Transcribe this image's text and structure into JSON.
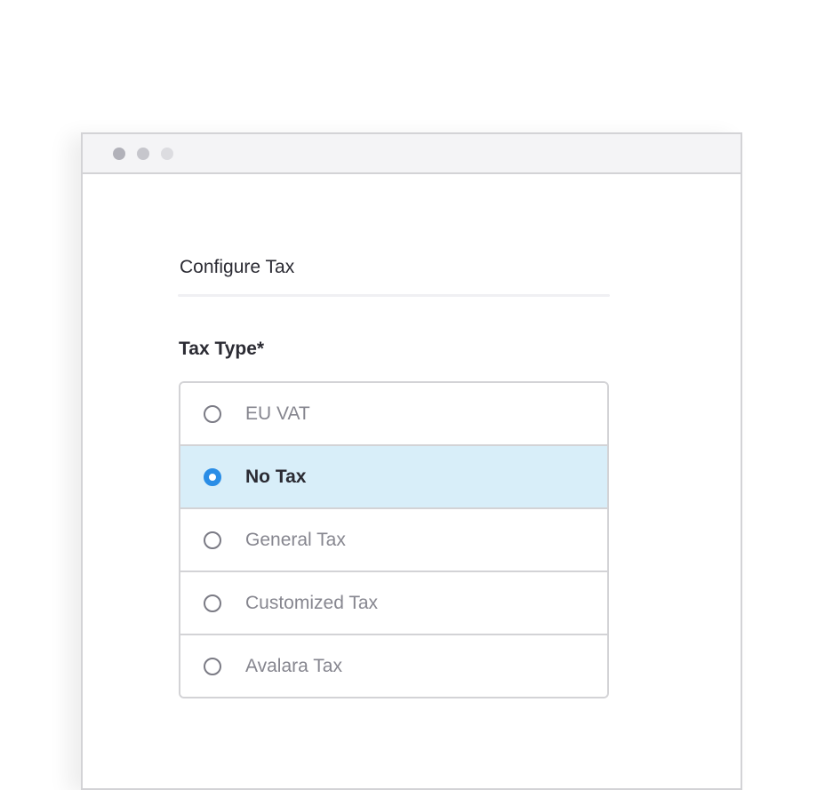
{
  "window": {
    "controls": [
      "close-dot",
      "minimize-dot",
      "maximize-dot"
    ]
  },
  "form": {
    "title": "Configure Tax",
    "field_label": "Tax Type*",
    "selected_value": "No Tax",
    "options": [
      {
        "label": "EU VAT",
        "selected": false
      },
      {
        "label": "No Tax",
        "selected": true
      },
      {
        "label": "General Tax",
        "selected": false
      },
      {
        "label": "Customized Tax",
        "selected": false
      },
      {
        "label": "Avalara Tax",
        "selected": false
      }
    ]
  },
  "colors": {
    "accent": "#2a8de6",
    "selected_row_bg": "#d8eef9",
    "text_primary": "#2b2b33",
    "text_muted": "#86868f"
  }
}
